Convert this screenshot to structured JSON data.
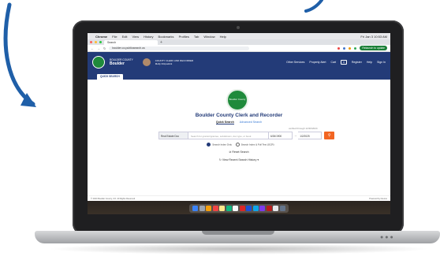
{
  "menubar": {
    "app": "Chrome",
    "items": [
      "File",
      "Edit",
      "View",
      "History",
      "Bookmarks",
      "Profiles",
      "Tab",
      "Window",
      "Help"
    ],
    "clock": "Fri Jan 3 10:53 AM"
  },
  "browser": {
    "tab_title": "Search",
    "url": "boulder.co.publicsearch.us",
    "relaunch_label": "Relaunch to update"
  },
  "site_header": {
    "site_small": "BOULDER COUNTY",
    "site_name": "Boulder",
    "user_role": "COUNTY CLERK AND RECORDER",
    "user_name": "Molly Fitzpatrick",
    "links": {
      "other_services": "Other Services",
      "property_alert": "Property Alert",
      "cart": "Cart",
      "cart_count": "0",
      "register": "Register",
      "help": "Help",
      "sign_in": "Sign In"
    },
    "quick_search_tab": "QUICK SEARCH"
  },
  "main": {
    "logo_text": "Boulder County",
    "title": "Boulder County Clerk and Recorder",
    "tabs": {
      "quick": "Quick Search",
      "advanced": "Advanced Search"
    },
    "verified": "verified through 12/30/2024",
    "search": {
      "type": "Real Estate Doc",
      "placeholder": "Search for grantor/grantee, subdivision, doc type, or book",
      "date_from": "6/26/1900",
      "date_to": "1/2/2025"
    },
    "radios": {
      "index_only": "Search Index Only",
      "full_text": "Search Index & Full Text (OCR)"
    },
    "reset": "Reset Search",
    "recent": "View Recent Search History"
  },
  "footer": {
    "left": "© 2024 Boulder County, CO. All Rights Reserved",
    "right": "Powered by Neumo"
  },
  "colors": {
    "header_blue": "#233b78",
    "search_orange": "#f26522",
    "arrow_blue": "#1f5fa8",
    "logo_green": "#1f8a3b"
  }
}
